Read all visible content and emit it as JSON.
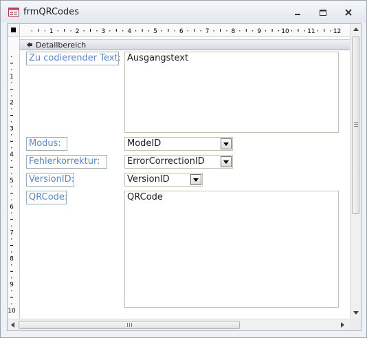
{
  "window": {
    "title": "frmQRCodes",
    "app_icon": "form-icon",
    "controls": [
      "minimize-icon",
      "maximize-icon",
      "close-icon"
    ]
  },
  "ruler": {
    "horizontal_marks": [
      "1",
      "2",
      "3",
      "4",
      "5",
      "6",
      "7",
      "8",
      "9",
      "10",
      "11",
      "12"
    ],
    "vertical_marks": [
      "1",
      "2",
      "3",
      "4",
      "5",
      "6",
      "7",
      "8",
      "9",
      "10"
    ]
  },
  "section": {
    "label": "Detailbereich",
    "icon": "section-collapse-icon"
  },
  "fields": [
    {
      "label": "Zu codierender Text:",
      "control": "Ausgangstext",
      "type": "textbox"
    },
    {
      "label": "Modus:",
      "control": "ModeID",
      "type": "combobox"
    },
    {
      "label": "Fehlerkorrektur:",
      "control": "ErrorCorrectionID",
      "type": "combobox"
    },
    {
      "label": "VersionID:",
      "control": "VersionID",
      "type": "combobox"
    },
    {
      "label": "QRCode:",
      "control": "QRCode",
      "type": "image-box"
    }
  ],
  "scrollbars": {
    "up_icon": "scroll-up-icon",
    "down_icon": "scroll-down-icon",
    "left_icon": "scroll-left-icon",
    "right_icon": "scroll-right-icon"
  },
  "colors": {
    "label_text": "#5c88c5",
    "label_border": "#9dacbb",
    "control_border": "#c6c1ae",
    "title_bar": "#e8ecf1"
  }
}
